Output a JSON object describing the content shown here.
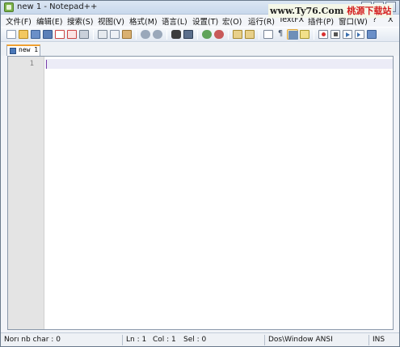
{
  "window": {
    "title": "new 1 - Notepad++"
  },
  "watermark": {
    "url": "www.Ty76.Com",
    "name": "桃源下载站"
  },
  "menu": {
    "items": [
      {
        "label": "文件(F)"
      },
      {
        "label": "编辑(E)"
      },
      {
        "label": "搜索(S)"
      },
      {
        "label": "视图(V)"
      },
      {
        "label": "格式(M)"
      },
      {
        "label": "语言(L)"
      },
      {
        "label": "设置(T)"
      },
      {
        "label": "宏(O)"
      },
      {
        "label": "运行(R)"
      },
      {
        "label": "TextFX"
      },
      {
        "label": "插件(P)"
      },
      {
        "label": "窗口(W)"
      },
      {
        "label": "?"
      },
      {
        "label": "X"
      }
    ]
  },
  "toolbar": {
    "icons": [
      "new-file-icon",
      "open-file-icon",
      "save-icon",
      "save-all-icon",
      "close-icon",
      "close-all-icon",
      "print-icon",
      "cut-icon",
      "copy-icon",
      "paste-icon",
      "undo-icon",
      "redo-icon",
      "find-icon",
      "replace-icon",
      "zoom-in-icon",
      "zoom-out-icon",
      "sync-vertical-icon",
      "sync-horizontal-icon",
      "word-wrap-icon",
      "show-all-chars-icon",
      "indent-guide-icon",
      "user-language-icon",
      "record-macro-icon",
      "stop-record-icon",
      "play-macro-icon",
      "run-macro-multiple-icon",
      "save-macro-icon"
    ]
  },
  "tabs": [
    {
      "label": "new 1"
    }
  ],
  "editor": {
    "line_numbers": [
      "1"
    ]
  },
  "status": {
    "length": "Norı nb char : 0",
    "ln": "Ln : 1",
    "col": "Col : 1",
    "sel": "Sel : 0",
    "eol_encoding": "Dos\\Window ANSI",
    "mode": "INS"
  },
  "colors": {
    "accent_tab": "#f0a030",
    "watermark_red": "#d42020",
    "gutter": "#e4e4e4"
  }
}
